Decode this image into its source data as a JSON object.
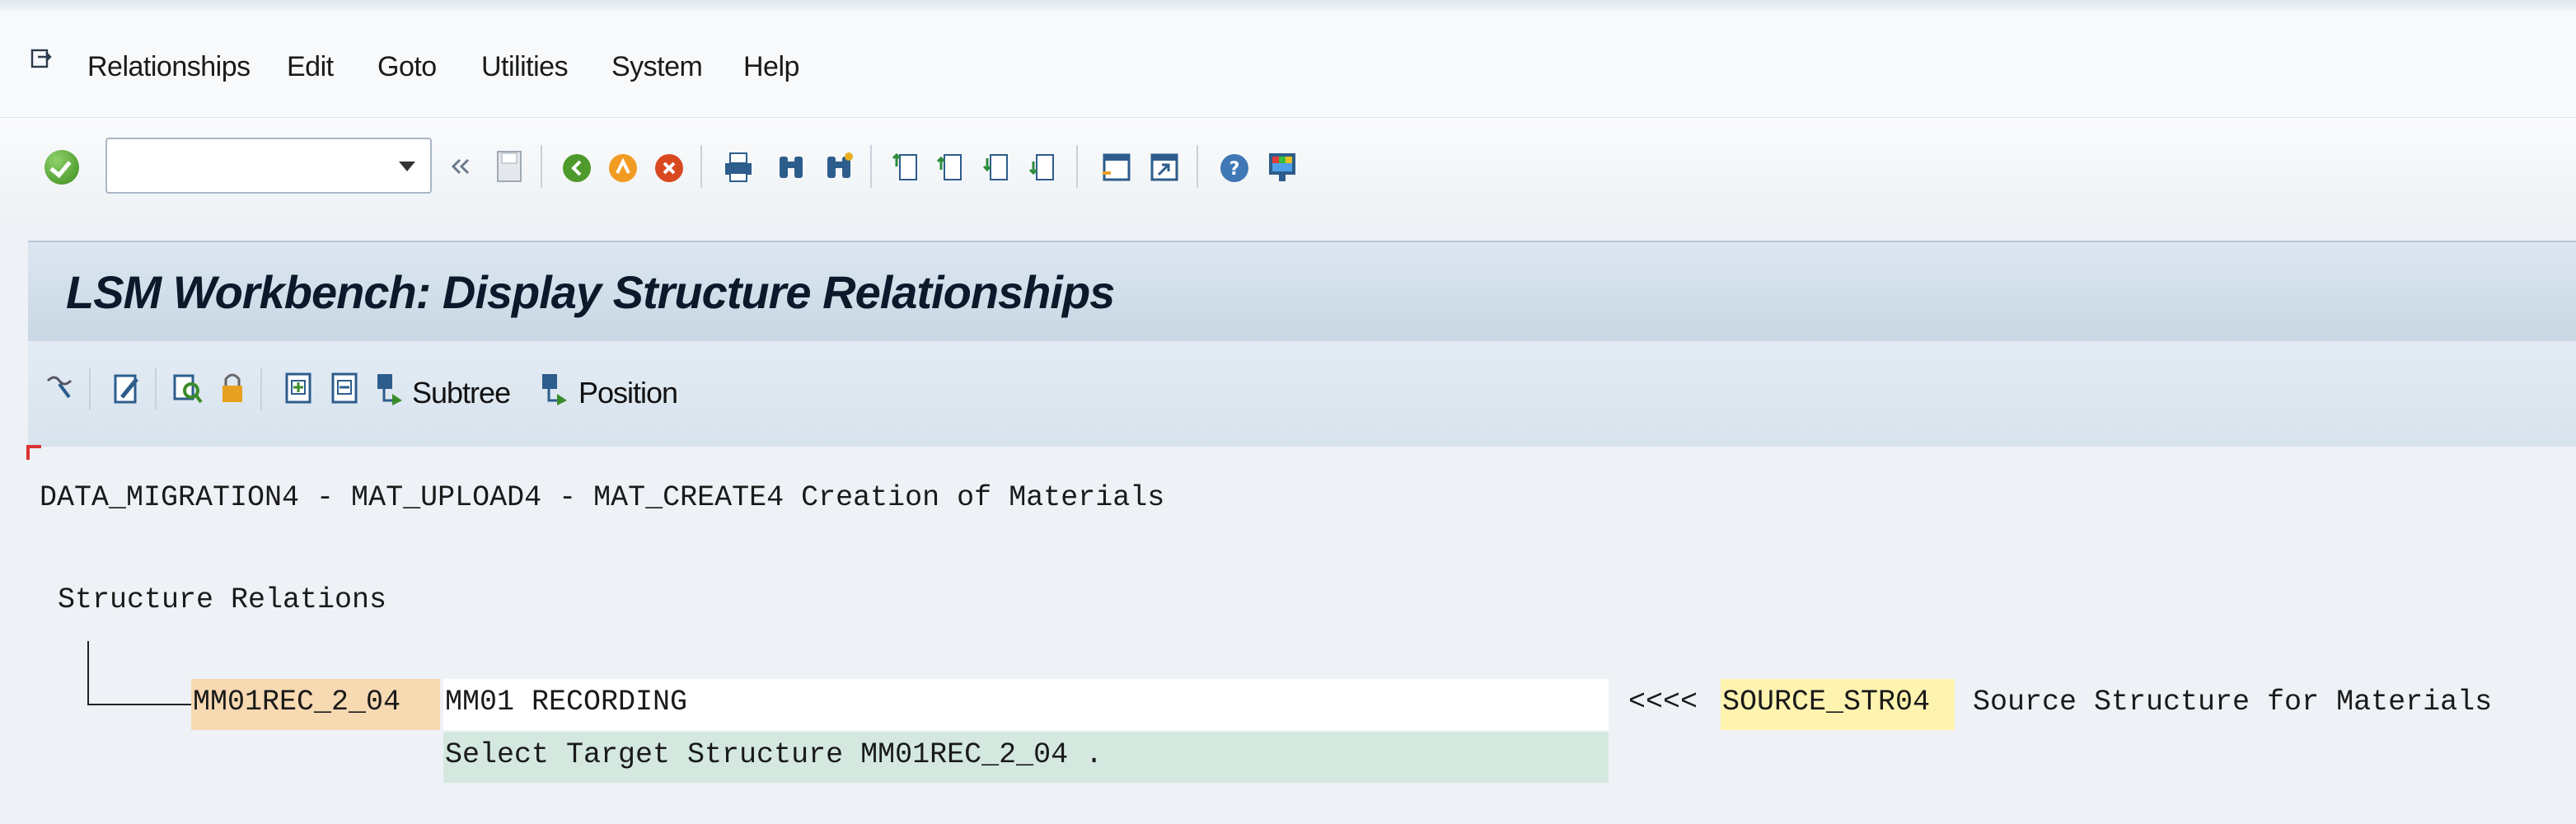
{
  "menu": {
    "items": [
      "Relationships",
      "Edit",
      "Goto",
      "Utilities",
      "System",
      "Help"
    ]
  },
  "toolbar": {
    "command_field_value": "",
    "icons": [
      "enter-icon",
      "save-icon",
      "back-icon",
      "exit-icon",
      "cancel-icon",
      "print-icon",
      "find-icon",
      "find-next-icon",
      "first-page-icon",
      "previous-page-icon",
      "next-page-icon",
      "last-page-icon",
      "create-session-icon",
      "shortcut-icon",
      "help-icon",
      "customize-layout-icon"
    ]
  },
  "title": "LSM Workbench: Display Structure Relationships",
  "app_toolbar": {
    "subtree_label": "Subtree",
    "position_label": "Position"
  },
  "content": {
    "header_line": "DATA_MIGRATION4 - MAT_UPLOAD4 - MAT_CREATE4 Creation of Materials",
    "section_label": "Structure Relations",
    "target_structure": "MM01REC_2_04",
    "target_description": "MM01 RECORDING",
    "arrow": "<<<<",
    "source_structure": "SOURCE_STR04",
    "source_description": "Source Structure for Materials",
    "select_hint": "Select Target Structure MM01REC_2_04 ."
  },
  "colors": {
    "title_band": "#c9d7e4",
    "target_highlight": "#f7d9b2",
    "source_highlight": "#fff3b0",
    "hint_highlight": "#d4e8e0"
  }
}
